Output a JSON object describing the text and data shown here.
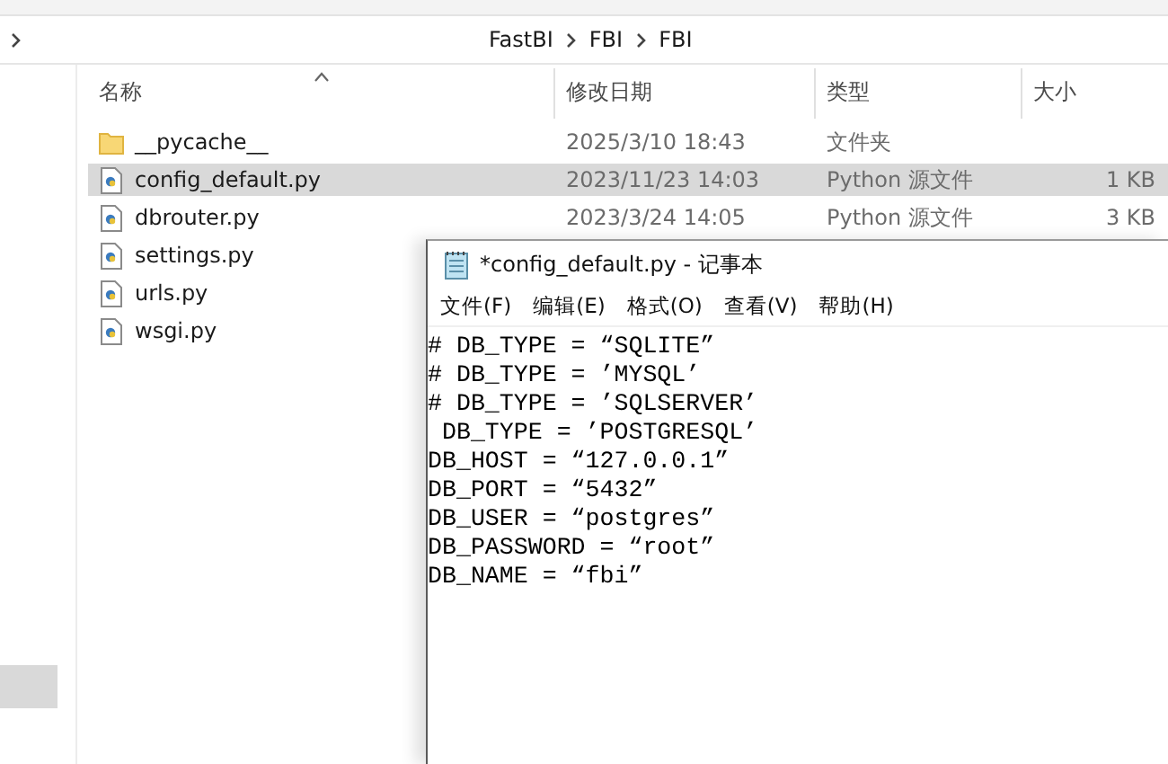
{
  "address_bar": {
    "path": [
      {
        "label": "FastBI"
      },
      {
        "label": "FBI"
      },
      {
        "label": "FBI"
      }
    ]
  },
  "columns": [
    {
      "label": "名称",
      "sorted": true
    },
    {
      "label": "修改日期",
      "sorted": false
    },
    {
      "label": "类型",
      "sorted": false
    },
    {
      "label": "大小",
      "sorted": false
    }
  ],
  "files": [
    {
      "kind": "folder",
      "name": "__pycache__",
      "date": "2025/3/10 18:43",
      "type": "文件夹",
      "selected": false
    },
    {
      "kind": "python",
      "name": "config_default.py",
      "date": "2023/11/23 14:03",
      "type": "Python 源文件",
      "size": "1 KB",
      "selected": true
    },
    {
      "kind": "python",
      "name": "dbrouter.py",
      "date": "2023/3/24 14:05",
      "type": "Python 源文件",
      "size": "3 KB",
      "selected": false
    },
    {
      "kind": "python",
      "name": "settings.py",
      "selected": false
    },
    {
      "kind": "python",
      "name": "urls.py",
      "selected": false
    },
    {
      "kind": "python",
      "name": "wsgi.py",
      "selected": false
    }
  ],
  "notepad": {
    "title": "*config_default.py - 记事本",
    "menu": [
      "文件(F)",
      "编辑(E)",
      "格式(O)",
      "查看(V)",
      "帮助(H)"
    ],
    "lines": [
      "# DB_TYPE = “SQLITE”",
      "# DB_TYPE = ’MYSQL’",
      "# DB_TYPE = ’SQLSERVER’",
      " DB_TYPE = ’POSTGRESQL’",
      "DB_HOST = “127.0.0.1”",
      "DB_PORT = “5432”",
      "DB_USER = “postgres”",
      "DB_PASSWORD = “root”",
      "DB_NAME = “fbi”"
    ]
  }
}
